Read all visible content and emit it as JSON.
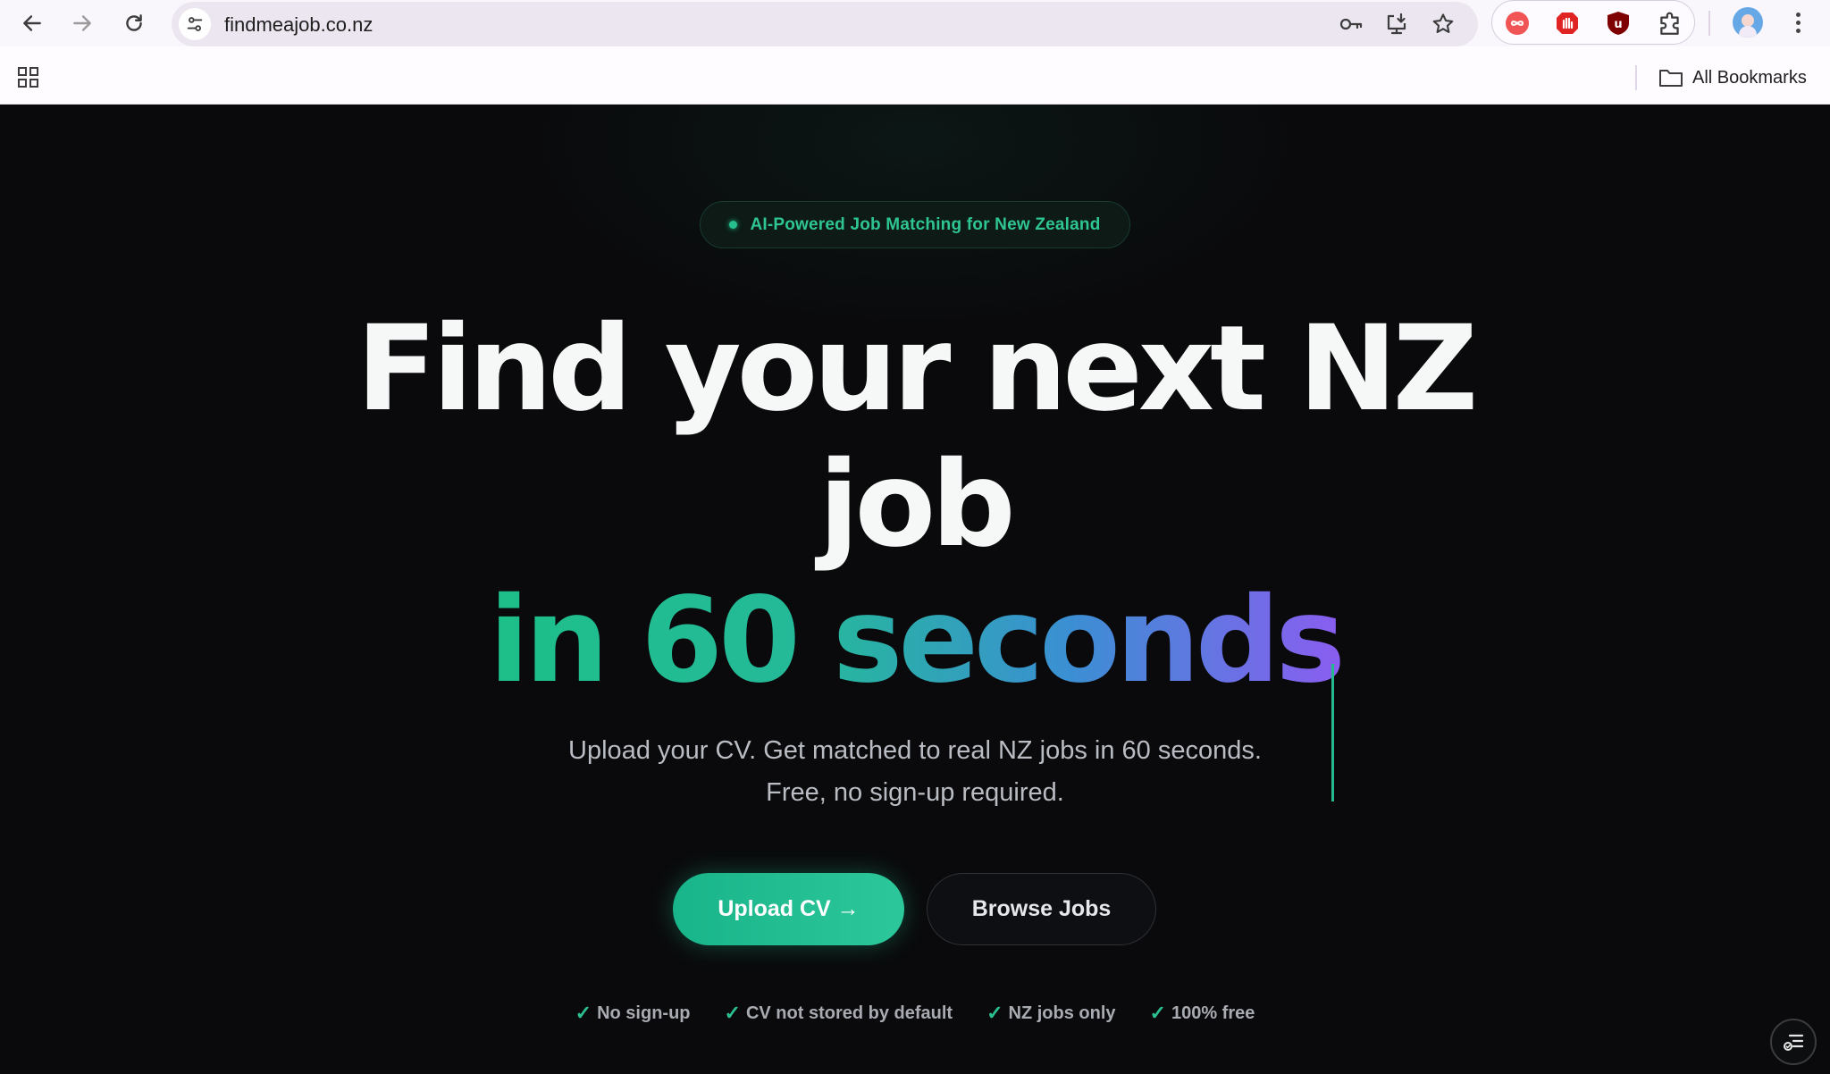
{
  "browser": {
    "url": "findmeajob.co.nz",
    "bookmarks_label": "All Bookmarks",
    "extensions": [
      {
        "name": "infinity-extension",
        "color": "#e94b4b",
        "glyph": "∞"
      },
      {
        "name": "stop-extension",
        "color": "#e02424",
        "glyph": "✋"
      },
      {
        "name": "ublock-extension",
        "color": "#8b0000",
        "glyph": "U"
      }
    ]
  },
  "hero": {
    "badge_text": "AI-Powered Job Matching for New Zealand",
    "headline_line1": "Find your next NZ",
    "headline_line2": "job",
    "headline_line3": "in 60 seconds",
    "subtitle": "Upload your CV. Get matched to real NZ jobs in 60 seconds. Free, no sign-up required.",
    "primary_cta": "Upload CV →",
    "secondary_cta": "Browse Jobs",
    "features": [
      {
        "check": "✓",
        "label": "No sign-up"
      },
      {
        "check": "✓",
        "label": "CV not stored by default"
      },
      {
        "check": "✓",
        "label": "NZ jobs only"
      },
      {
        "check": "✓",
        "label": "100% free"
      }
    ]
  },
  "colors": {
    "accent": "#25c08e",
    "gradient_start": "#1dbf88",
    "gradient_end": "#8a5df0",
    "background": "#0a0a0c"
  }
}
